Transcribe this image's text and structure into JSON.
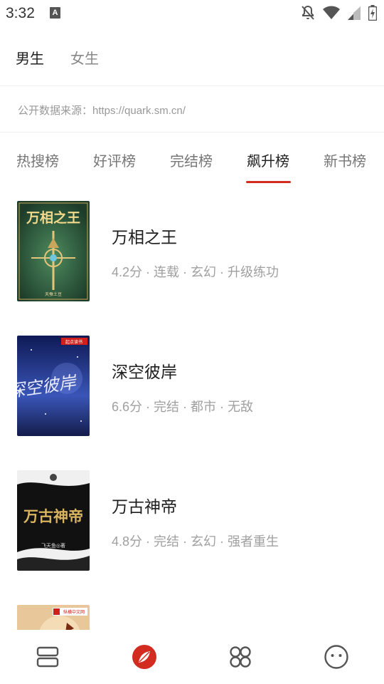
{
  "status_bar": {
    "time": "3:32",
    "notification_icon_letter": "A",
    "icons": [
      "notifications-off-icon",
      "wifi-icon",
      "signal-icon",
      "battery-charging-icon"
    ]
  },
  "gender_tabs": [
    {
      "label": "男生",
      "active": true
    },
    {
      "label": "女生",
      "active": false
    }
  ],
  "source_text": "公开数据来源：https://quark.sm.cn/",
  "rank_tabs": [
    {
      "label": "热搜榜",
      "active": false
    },
    {
      "label": "好评榜",
      "active": false
    },
    {
      "label": "完结榜",
      "active": false
    },
    {
      "label": "飙升榜",
      "active": true
    },
    {
      "label": "新书榜",
      "active": false
    }
  ],
  "books": [
    {
      "title": "万相之王",
      "meta": "4.2分 · 连载 · 玄幻 · 升级练功",
      "cover_text": "万相之王",
      "cover_author": "天蚕土豆",
      "cover_color": "#2f5a3f"
    },
    {
      "title": "深空彼岸",
      "meta": "6.6分 · 完结 · 都市 · 无敌",
      "cover_text": "深空彼岸",
      "cover_badge": "起点读书",
      "cover_color": "#1b2a6b"
    },
    {
      "title": "万古神帝",
      "meta": "4.8分 · 完结 · 玄幻 · 强者重生",
      "cover_text": "万古神帝",
      "cover_author": "飞天鱼◎著",
      "cover_color": "#111111"
    },
    {
      "title": "",
      "meta": "",
      "cover_badge": "纵横中文网",
      "cover_color": "#e8c79a"
    }
  ],
  "colors": {
    "accent": "#d32b1f",
    "active_text": "#222222",
    "inactive_text": "#888888"
  },
  "bottom_nav": [
    {
      "icon": "bookshelf-icon",
      "active": false
    },
    {
      "icon": "discover-compass-icon",
      "active": true
    },
    {
      "icon": "categories-grid-icon",
      "active": false
    },
    {
      "icon": "profile-face-icon",
      "active": false
    }
  ]
}
